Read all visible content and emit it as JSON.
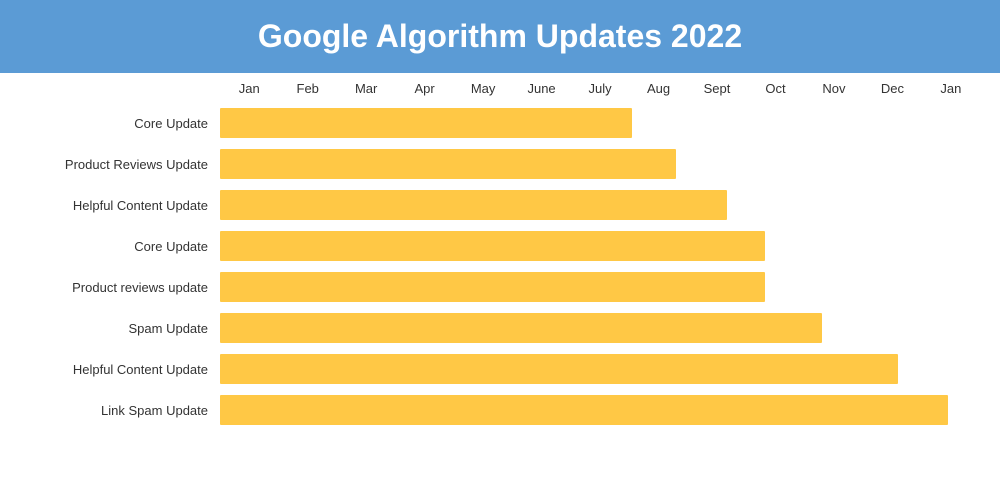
{
  "header": {
    "title": "Google Algorithm Updates 2022"
  },
  "months": [
    "Jan",
    "Feb",
    "Mar",
    "Apr",
    "May",
    "June",
    "July",
    "Aug",
    "Sept",
    "Oct",
    "Nov",
    "Dec",
    "Jan"
  ],
  "bars": [
    {
      "label": "Core Update",
      "start": 0,
      "end": 6.5
    },
    {
      "label": "Product Reviews Update",
      "start": 0,
      "end": 7.2
    },
    {
      "label": "Helpful Content Update",
      "start": 0,
      "end": 8.0
    },
    {
      "label": "Core Update",
      "start": 0,
      "end": 8.6
    },
    {
      "label": "Product reviews update",
      "start": 0,
      "end": 8.6
    },
    {
      "label": "Spam Update",
      "start": 0,
      "end": 9.5
    },
    {
      "label": "Helpful Content Update",
      "start": 0,
      "end": 10.7
    },
    {
      "label": "Link Spam Update",
      "start": 0,
      "end": 11.5
    }
  ],
  "chart": {
    "totalMonths": 12
  }
}
